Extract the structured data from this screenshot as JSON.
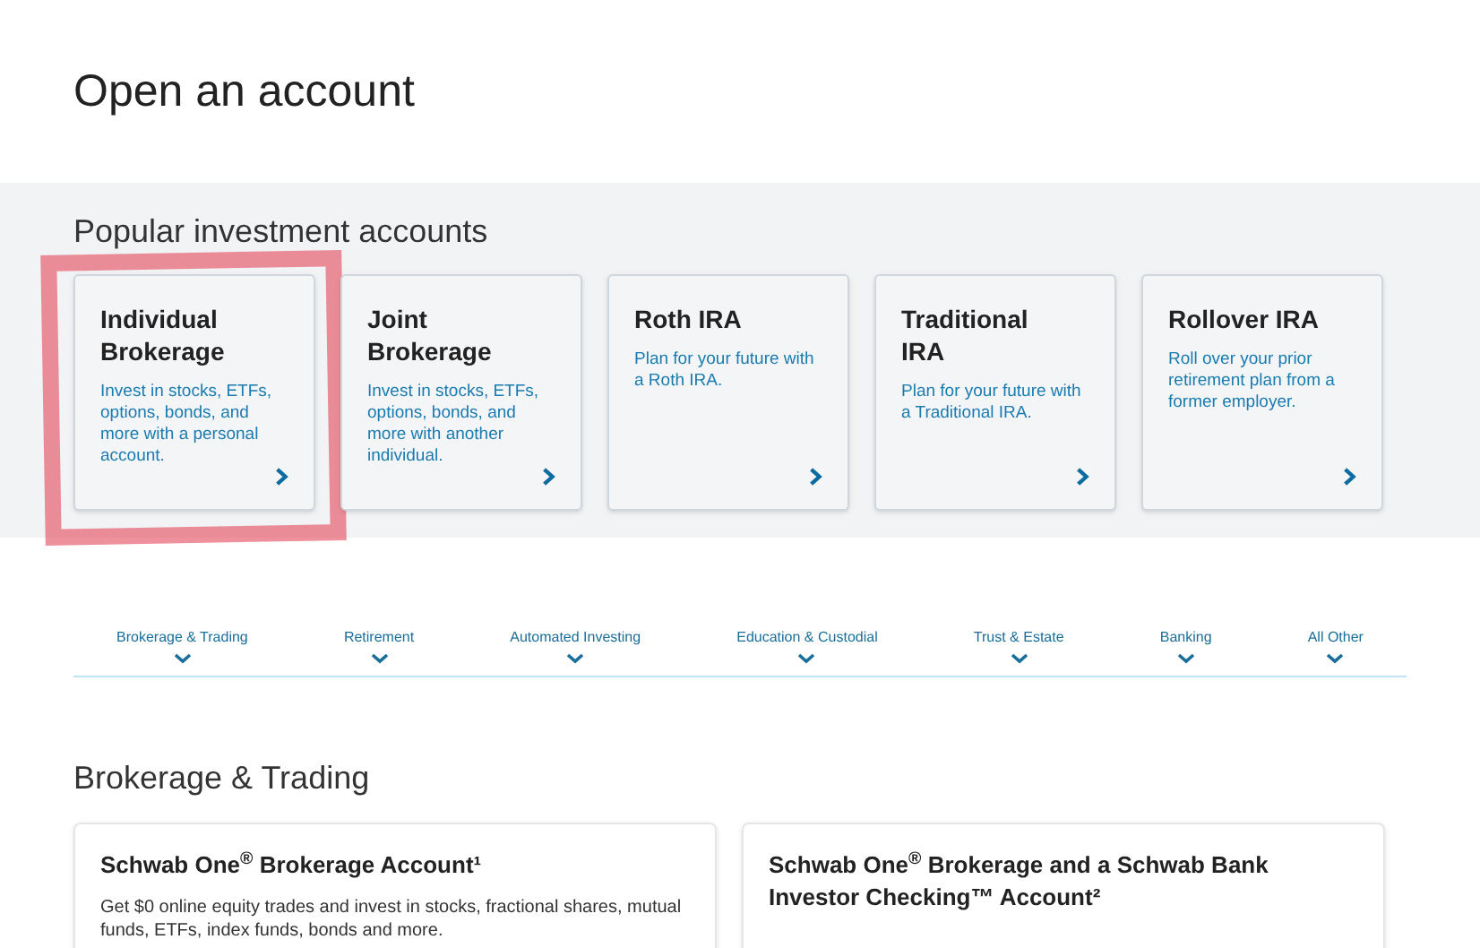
{
  "page_title": "Open an account",
  "popular": {
    "heading": "Popular investment accounts",
    "cards": [
      {
        "title": "Individual Brokerage",
        "description": "Invest in stocks, ETFs, options, bonds, and more with a personal account.",
        "highlighted": true
      },
      {
        "title": "Joint Brokerage",
        "description": "Invest in stocks, ETFs, options, bonds, and more with another individual.",
        "highlighted": false
      },
      {
        "title": "Roth IRA",
        "description": "Plan for your future with a Roth IRA.",
        "highlighted": false
      },
      {
        "title": "Traditional IRA",
        "description": "Plan for your future with a Traditional IRA.",
        "highlighted": false
      },
      {
        "title": "Rollover IRA",
        "description": "Roll over your prior retirement plan from a former employer.",
        "highlighted": false
      }
    ]
  },
  "categories": [
    "Brokerage & Trading",
    "Retirement",
    "Automated Investing",
    "Education & Custodial",
    "Trust & Estate",
    "Banking",
    "All Other"
  ],
  "section": {
    "heading": "Brokerage & Trading",
    "cards": [
      {
        "title": "Schwab One$^{®}$ Brokerage Account¹",
        "description": "Get $0 online equity trades and invest in stocks, fractional shares, mutual funds, ETFs, index funds, bonds and more."
      },
      {
        "title": "Schwab One$^{®}$ Brokerage and a Schwab Bank Investor Checking™ Account²"
      }
    ]
  }
}
